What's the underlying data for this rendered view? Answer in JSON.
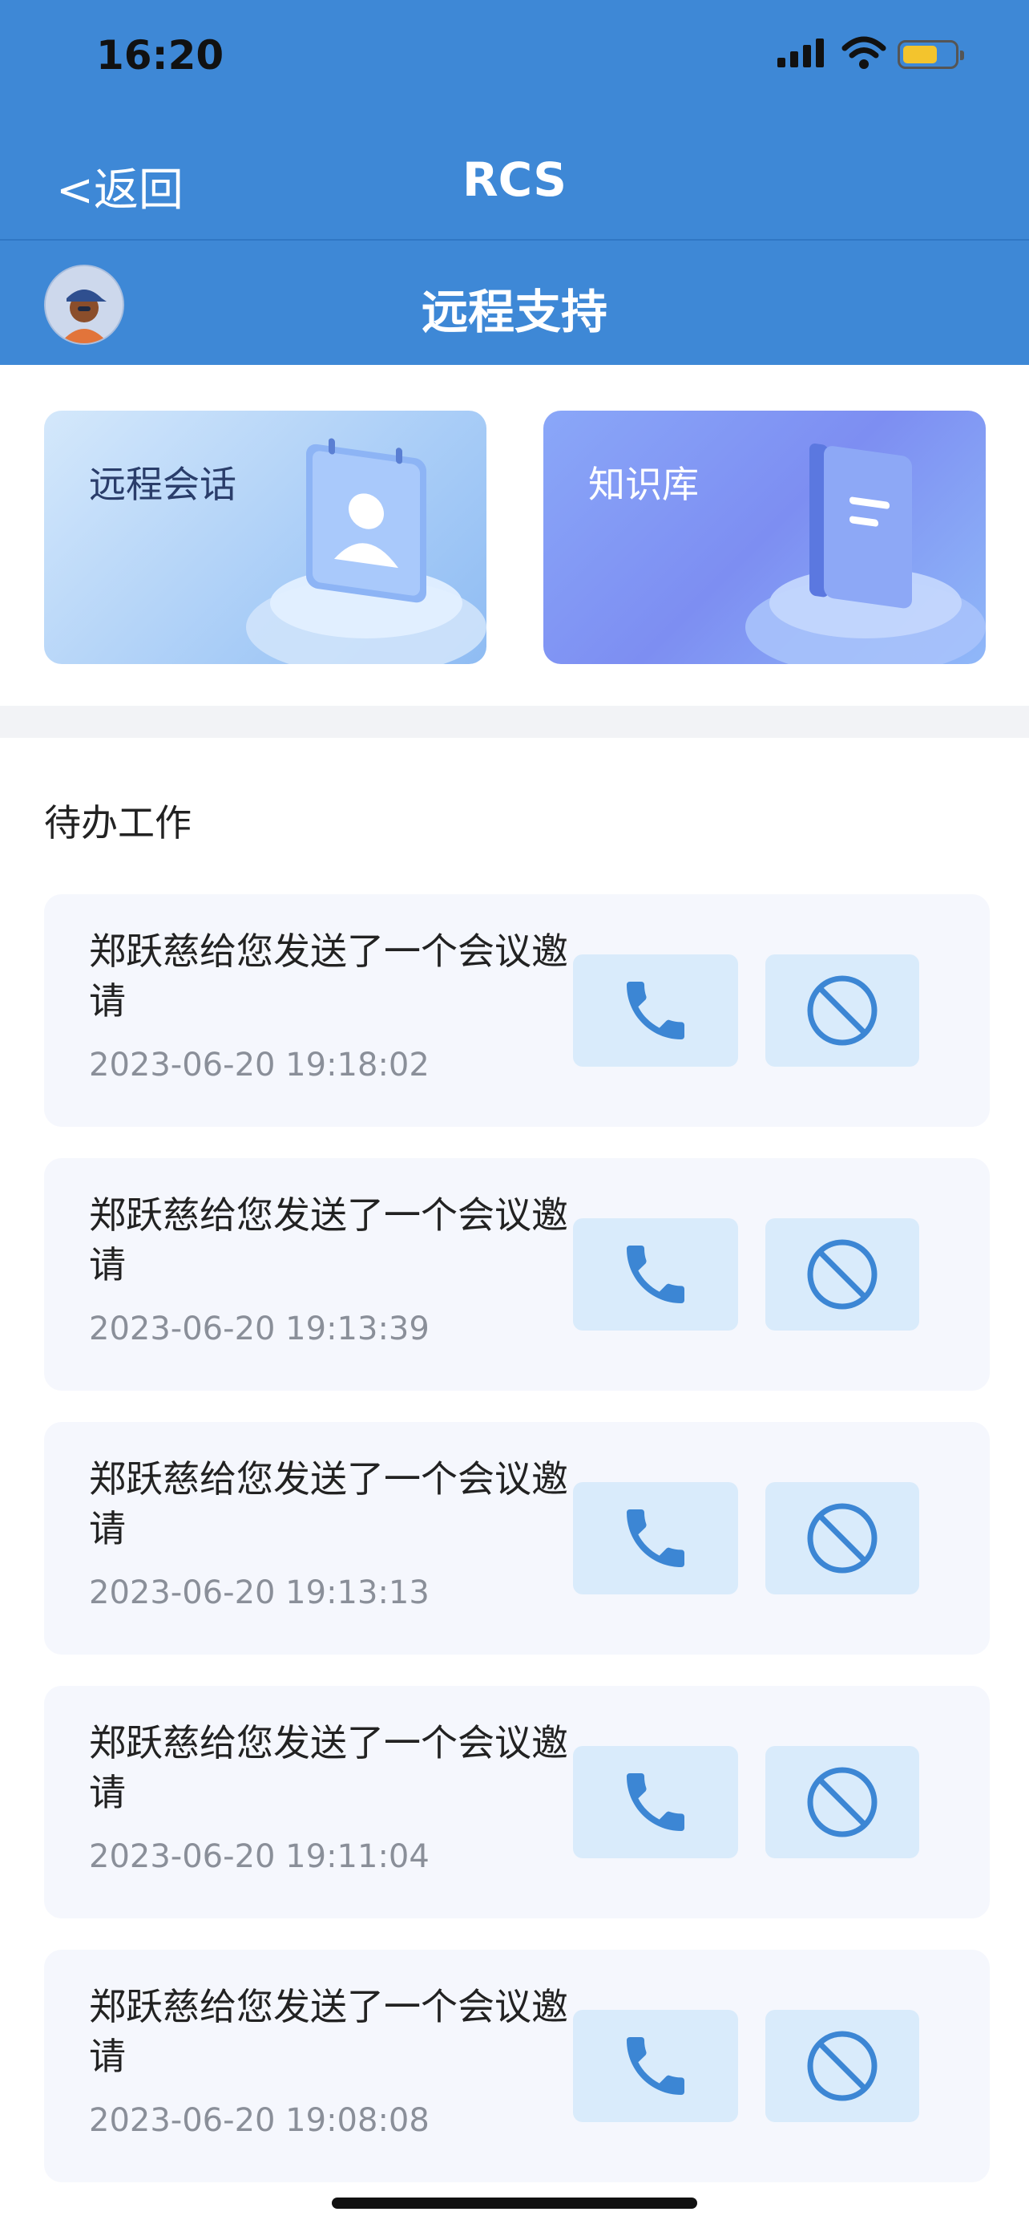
{
  "status_bar": {
    "time": "16:20",
    "icons": [
      "signal-icon",
      "wifi-icon",
      "battery-icon"
    ]
  },
  "nav": {
    "back_label": "<返回",
    "title": "RCS"
  },
  "subheader": {
    "title": "远程支持",
    "avatar": "avatar"
  },
  "tiles": [
    {
      "label": "远程会话",
      "icon": "contact-card-icon"
    },
    {
      "label": "知识库",
      "icon": "book-icon"
    }
  ],
  "section": {
    "title": "待办工作"
  },
  "todo_items": [
    {
      "message": "郑跃慈给您发送了一个会议邀请",
      "time": "2023-06-20 19:18:02"
    },
    {
      "message": "郑跃慈给您发送了一个会议邀请",
      "time": "2023-06-20 19:13:39"
    },
    {
      "message": "郑跃慈给您发送了一个会议邀请",
      "time": "2023-06-20 19:13:13"
    },
    {
      "message": "郑跃慈给您发送了一个会议邀请",
      "time": "2023-06-20 19:11:04"
    },
    {
      "message": "郑跃慈给您发送了一个会议邀请",
      "time": "2023-06-20 19:08:08"
    }
  ],
  "colors": {
    "primary": "#3e88d6",
    "button_bg": "#d9ebfb",
    "icon_blue": "#3c86d4",
    "card_bg": "#f5f7fd"
  }
}
